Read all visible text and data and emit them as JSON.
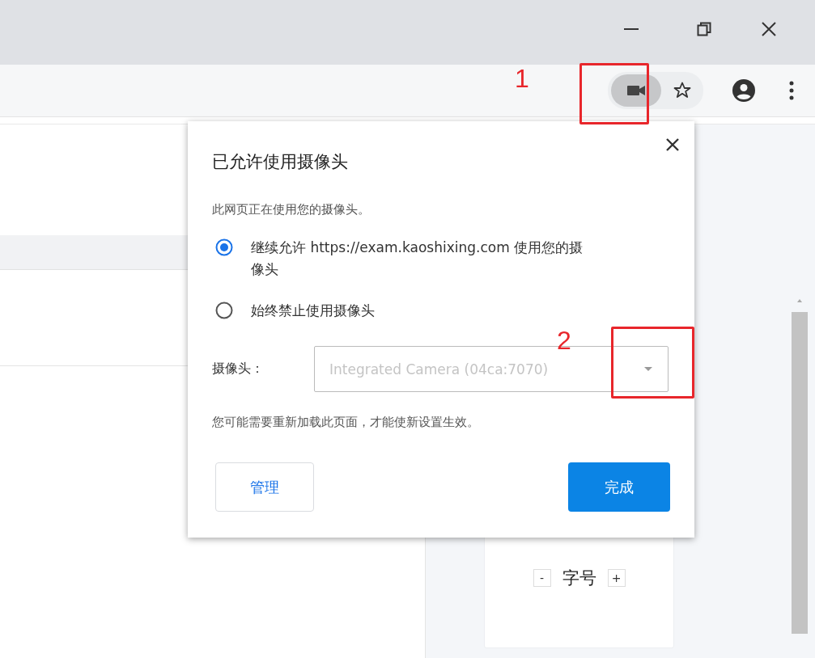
{
  "permission_popup": {
    "title": "已允许使用摄像头",
    "description": "此网页正在使用您的摄像头。",
    "options": [
      {
        "label": "继续允许 https://exam.kaoshixing.com 使用您的摄像头",
        "selected": true
      },
      {
        "label": "始终禁止使用摄像头",
        "selected": false
      }
    ],
    "camera_label": "摄像头：",
    "camera_select": {
      "value": "Integrated Camera (04ca:7070)",
      "disabled": true
    },
    "note": "您可能需要重新加载此页面，才能使新设置生效。",
    "buttons": [
      {
        "label": "管理",
        "kind": "secondary"
      },
      {
        "label": "完成",
        "kind": "primary"
      }
    ]
  },
  "font_size_control": {
    "decrease": "-",
    "label": "字号",
    "increase": "+"
  },
  "annotations": [
    {
      "label": "1"
    },
    {
      "label": "2"
    }
  ]
}
